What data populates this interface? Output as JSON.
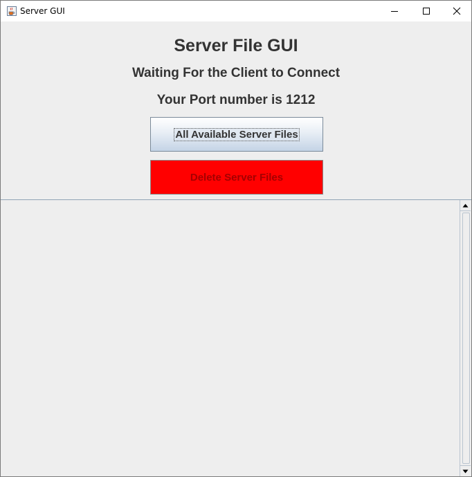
{
  "window": {
    "title": "Server GUI",
    "icon": "java-cup-icon"
  },
  "header": {
    "title": "Server File GUI",
    "status": "Waiting For the Client to Connect",
    "port": "Your Port number is 1212"
  },
  "buttons": {
    "all_files_label": "All Available Server Files",
    "delete_label": "Delete Server Files"
  },
  "colors": {
    "delete_bg": "#ff0000",
    "delete_text": "#a50000",
    "window_bg": "#eeeeee"
  },
  "log": {
    "text": ""
  }
}
